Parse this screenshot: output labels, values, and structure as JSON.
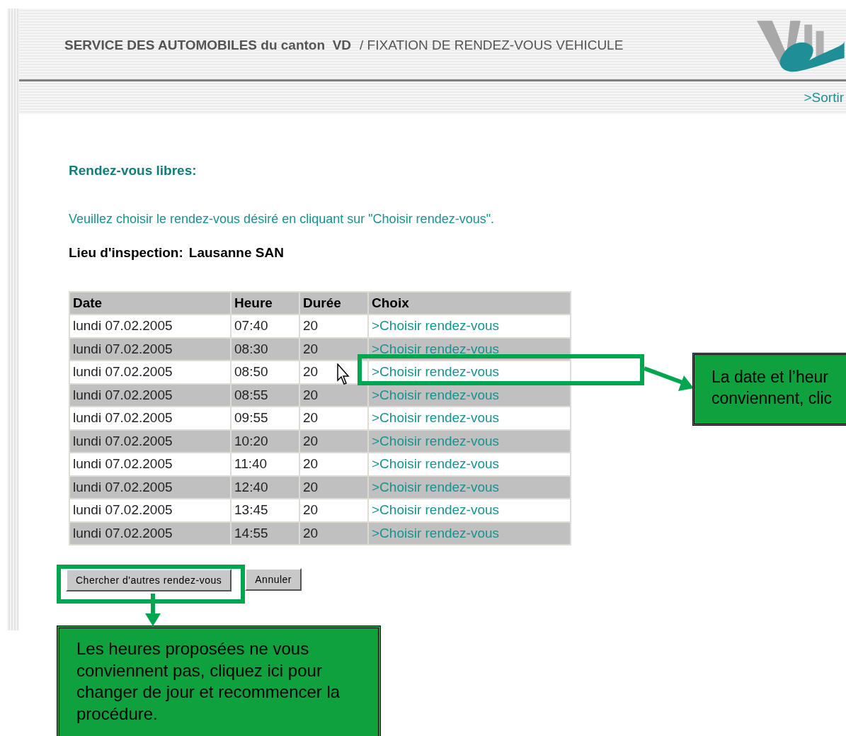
{
  "header": {
    "service": "SERVICE DES AUTOMOBILES du canton  VD",
    "title": "/ FIXATION DE RENDEZ-VOUS VEHICULE",
    "exit_link": ">Sortir"
  },
  "heading": "Rendez-vous libres:",
  "instruction": "Veuillez choisir le rendez-vous désiré en cliquant sur \"Choisir rendez-vous\".",
  "location": {
    "label": "Lieu d'inspection:",
    "value": "Lausanne SAN"
  },
  "table": {
    "columns": [
      "Date",
      "Heure",
      "Durée",
      "Choix"
    ],
    "rows": [
      {
        "date": "lundi 07.02.2005",
        "time": "07:40",
        "duration": "20",
        "action": ">Choisir rendez-vous",
        "highlighted": false
      },
      {
        "date": "lundi 07.02.2005",
        "time": "08:30",
        "duration": "20",
        "action": ">Choisir rendez-vous",
        "highlighted": false
      },
      {
        "date": "lundi 07.02.2005",
        "time": "08:50",
        "duration": "20",
        "action": ">Choisir rendez-vous",
        "highlighted": true
      },
      {
        "date": "lundi 07.02.2005",
        "time": "08:55",
        "duration": "20",
        "action": ">Choisir rendez-vous",
        "highlighted": false
      },
      {
        "date": "lundi 07.02.2005",
        "time": "09:55",
        "duration": "20",
        "action": ">Choisir rendez-vous",
        "highlighted": false
      },
      {
        "date": "lundi 07.02.2005",
        "time": "10:20",
        "duration": "20",
        "action": ">Choisir rendez-vous",
        "highlighted": false
      },
      {
        "date": "lundi 07.02.2005",
        "time": "11:40",
        "duration": "20",
        "action": ">Choisir rendez-vous",
        "highlighted": false
      },
      {
        "date": "lundi 07.02.2005",
        "time": "12:40",
        "duration": "20",
        "action": ">Choisir rendez-vous",
        "highlighted": false
      },
      {
        "date": "lundi 07.02.2005",
        "time": "13:45",
        "duration": "20",
        "action": ">Choisir rendez-vous",
        "highlighted": false
      },
      {
        "date": "lundi 07.02.2005",
        "time": "14:55",
        "duration": "20",
        "action": ">Choisir rendez-vous",
        "highlighted": false
      }
    ]
  },
  "buttons": [
    {
      "label": "Chercher d'autres rendez-vous",
      "highlighted": true
    },
    {
      "label": "Annuler",
      "highlighted": false
    }
  ],
  "callouts": {
    "row": {
      "lines": [
        "La date et l’heur",
        "conviennent, clic"
      ]
    },
    "button": {
      "text": "Les heures proposées ne vous conviennent pas, cliquez ici pour changer de jour et recommencer la procédure."
    }
  }
}
